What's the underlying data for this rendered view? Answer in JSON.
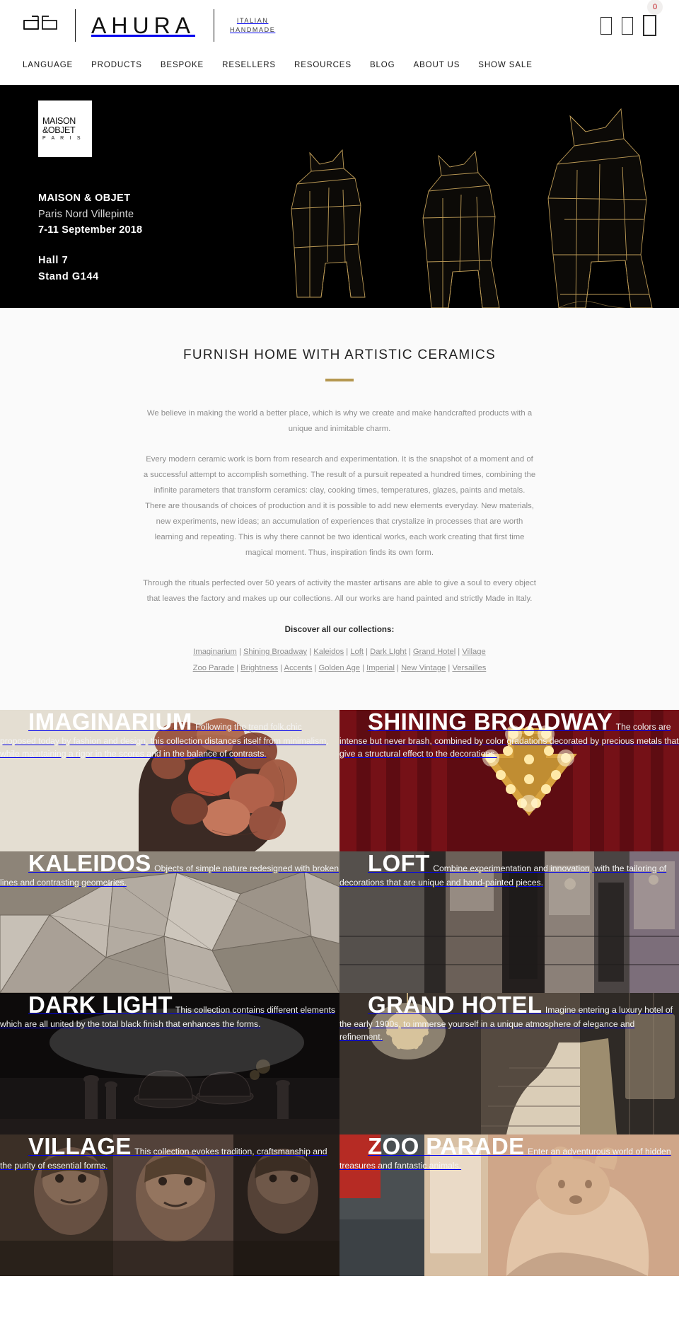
{
  "header": {
    "logo_mark_name": "ahura-monogram",
    "brand_name": "AHURA",
    "tagline_line1": "ITALIAN",
    "tagline_line2": "HANDMADE",
    "icons": [
      {
        "name": "search-icon",
        "glyph": "⠀"
      },
      {
        "name": "user-account-icon",
        "glyph": "⠀"
      },
      {
        "name": "shopping-cart-icon",
        "glyph": "⠀"
      }
    ],
    "cart_count": "0",
    "cart_badge_color": "#c0161d",
    "nav": [
      {
        "label": "LANGUAGE"
      },
      {
        "label": "PRODUCTS"
      },
      {
        "label": "BESPOKE"
      },
      {
        "label": "RESELLERS"
      },
      {
        "label": "RESOURCES"
      },
      {
        "label": "BLOG"
      },
      {
        "label": "ABOUT US"
      },
      {
        "label": "SHOW SALE"
      }
    ]
  },
  "hero": {
    "badge_line1": "MAISON",
    "badge_line2": "&OBJET",
    "badge_line3": "P A R I S",
    "event_name": "MAISON & OBJET",
    "venue": "Paris Nord Villepinte",
    "dates": "7-11 September 2018",
    "hall": "Hall  7",
    "stand": "Stand  G144",
    "background": "#000000",
    "artwork_name": "wireframe-gold-animal-sculptures"
  },
  "intro": {
    "title": "FURNISH HOME WITH ARTISTIC CERAMICS",
    "rule_color": "#b5974f",
    "paragraphs": [
      "We believe in making the world a better place, which is why we create and make handcrafted products with a unique and inimitable charm.",
      "Every modern ceramic work is born from research and experimentation. It is the snapshot of a moment and of a successful attempt to accomplish something. The result of a pursuit repeated a hundred times, combining the infinite parameters that transform ceramics: clay, cooking times, temperatures, glazes, paints and metals. There are thousands of choices of production and it is possible to add new elements everyday. New materials, new experiments, new ideas; an accumulation of experiences that crystalize in processes that are worth learning and repeating. This is why there cannot be two identical works, each work creating that first time magical moment. Thus, inspiration finds its own form.",
      "Through the rituals perfected over 50 years of activity the master artisans are able to give a soul to every object that leaves the factory and makes up our collections. All our works are hand painted and strictly Made in Italy."
    ],
    "discover_label": "Discover all our collections:",
    "links_row_1": [
      "Imaginarium",
      "Shining Broadway",
      "Kaleidos",
      "Loft",
      "Dark LIght",
      "Grand Hotel",
      "Village"
    ],
    "links_row_2": [
      "Zoo Parade",
      "Brightness",
      "Accents",
      "Golden Age",
      "Imperial",
      "New Vintage",
      "Versailles"
    ],
    "link_separator": "|"
  },
  "collections": [
    {
      "title": "IMAGINARIUM",
      "desc": "Following the trend folk.chic proposed today by fashion and design, this collection distances itself from minimalism, while maintaining a rigor in the scores and in the balance of contrasts.",
      "bg": "#e4ded2",
      "image_name": "floral-head-silhouette-illustration"
    },
    {
      "title": "SHINING BROADWAY",
      "desc": "The colors are intense but never brash, combined by color gradations decorated by precious metals that give a structural effect to the decorations.",
      "bg": "#6b0f14",
      "image_name": "theatre-marquee-arrow-lightbulbs"
    },
    {
      "title": "KALEIDOS",
      "desc": "Objects of simple nature redesigned with broken lines and contrasting geometries.",
      "bg": "#8a8073",
      "image_name": "faceted-geometric-ceramic-shapes"
    },
    {
      "title": "LOFT",
      "desc": "Combine experimentation and innovation, with the tailoring of decorations that are unique and hand-painted pieces.",
      "bg": "#4a4442",
      "image_name": "industrial-loft-interior"
    },
    {
      "title": "DARK LIGHT",
      "desc": "This collection contains different elements which are all united by the total black finish that enhances the forms.",
      "bg": "#121010",
      "image_name": "black-matte-tableware-still-life"
    },
    {
      "title": "GRAND HOTEL",
      "desc": "Imagine entering a luxury hotel of the early 1900s, to immerse yourself in a unique atmosphere of elegance and refinement.",
      "bg": "#2b2724",
      "image_name": "hotel-chandelier-staircase"
    },
    {
      "title": "VILLAGE",
      "desc": "This collection evokes tradition, craftsmanship and the purity of essential forms.",
      "bg": "#3a2f26",
      "image_name": "portrait-mural-faces"
    },
    {
      "title": "ZOO PARADE",
      "desc": "Enter an adventurous world of hidden treasures and fantastic animals.",
      "bg": "#c9a184",
      "image_name": "ceramic-animal-sculpture-interior"
    }
  ]
}
